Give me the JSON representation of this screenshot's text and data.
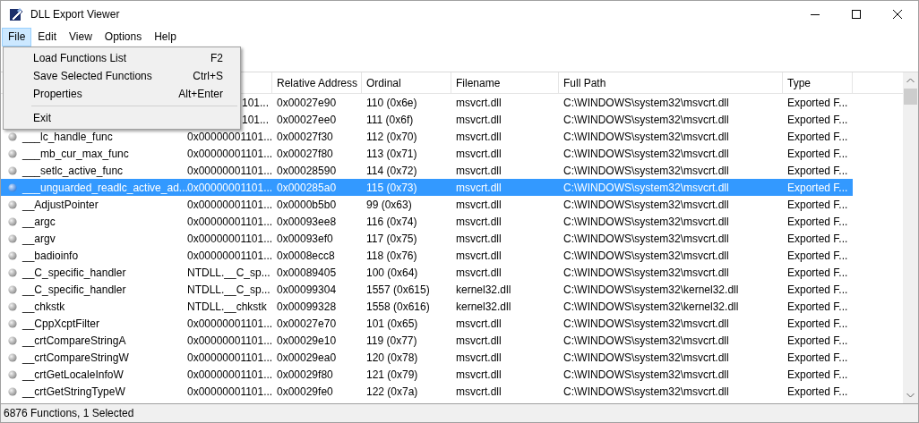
{
  "window": {
    "title": "DLL Export Viewer"
  },
  "menu_bar": [
    {
      "label": "File",
      "selected": true
    },
    {
      "label": "Edit",
      "selected": false
    },
    {
      "label": "View",
      "selected": false
    },
    {
      "label": "Options",
      "selected": false
    },
    {
      "label": "Help",
      "selected": false
    }
  ],
  "file_menu": [
    {
      "kind": "item",
      "label": "Load Functions List",
      "shortcut": "F2"
    },
    {
      "kind": "item",
      "label": "Save Selected Functions",
      "shortcut": "Ctrl+S"
    },
    {
      "kind": "item",
      "label": "Properties",
      "shortcut": "Alt+Enter"
    },
    {
      "kind": "separator"
    },
    {
      "kind": "item",
      "label": "Exit"
    }
  ],
  "table": {
    "columns": [
      "Relative Address",
      "Ordinal",
      "Filename",
      "Full Path",
      "Type"
    ],
    "rows": [
      {
        "address": "101...",
        "relative": "0x00027e90",
        "ordinal": "110 (0x6e)",
        "filename": "msvcrt.dll",
        "path": "C:\\WINDOWS\\system32\\msvcrt.dll",
        "type": "Exported F...",
        "selected": false
      },
      {
        "address": "101...",
        "relative": "0x00027ee0",
        "ordinal": "111 (0x6f)",
        "filename": "msvcrt.dll",
        "path": "C:\\WINDOWS\\system32\\msvcrt.dll",
        "type": "Exported F...",
        "selected": false
      },
      {
        "name": "___lc_handle_func",
        "address": "0x00000001101...",
        "relative": "0x00027f30",
        "ordinal": "112 (0x70)",
        "filename": "msvcrt.dll",
        "path": "C:\\WINDOWS\\system32\\msvcrt.dll",
        "type": "Exported F...",
        "selected": false
      },
      {
        "name": "___mb_cur_max_func",
        "address": "0x00000001101...",
        "relative": "0x00027f80",
        "ordinal": "113 (0x71)",
        "filename": "msvcrt.dll",
        "path": "C:\\WINDOWS\\system32\\msvcrt.dll",
        "type": "Exported F...",
        "selected": false
      },
      {
        "name": "___setlc_active_func",
        "address": "0x00000001101...",
        "relative": "0x00028590",
        "ordinal": "114 (0x72)",
        "filename": "msvcrt.dll",
        "path": "C:\\WINDOWS\\system32\\msvcrt.dll",
        "type": "Exported F...",
        "selected": false
      },
      {
        "name": "___unguarded_readlc_active_ad...",
        "address": "0x00000001101...",
        "relative": "0x000285a0",
        "ordinal": "115 (0x73)",
        "filename": "msvcrt.dll",
        "path": "C:\\WINDOWS\\system32\\msvcrt.dll",
        "type": "Exported F...",
        "selected": true
      },
      {
        "name": "__AdjustPointer",
        "address": "0x00000001101...",
        "relative": "0x0000b5b0",
        "ordinal": "99 (0x63)",
        "filename": "msvcrt.dll",
        "path": "C:\\WINDOWS\\system32\\msvcrt.dll",
        "type": "Exported F...",
        "selected": false
      },
      {
        "name": "__argc",
        "address": "0x00000001101...",
        "relative": "0x00093ee8",
        "ordinal": "116 (0x74)",
        "filename": "msvcrt.dll",
        "path": "C:\\WINDOWS\\system32\\msvcrt.dll",
        "type": "Exported F...",
        "selected": false
      },
      {
        "name": "__argv",
        "address": "0x00000001101...",
        "relative": "0x00093ef0",
        "ordinal": "117 (0x75)",
        "filename": "msvcrt.dll",
        "path": "C:\\WINDOWS\\system32\\msvcrt.dll",
        "type": "Exported F...",
        "selected": false
      },
      {
        "name": "__badioinfo",
        "address": "0x00000001101...",
        "relative": "0x0008ecc8",
        "ordinal": "118 (0x76)",
        "filename": "msvcrt.dll",
        "path": "C:\\WINDOWS\\system32\\msvcrt.dll",
        "type": "Exported F...",
        "selected": false
      },
      {
        "name": "__C_specific_handler",
        "address": "NTDLL.__C_sp...",
        "relative": "0x00089405",
        "ordinal": "100 (0x64)",
        "filename": "msvcrt.dll",
        "path": "C:\\WINDOWS\\system32\\msvcrt.dll",
        "type": "Exported F...",
        "selected": false
      },
      {
        "name": "__C_specific_handler",
        "address": "NTDLL.__C_sp...",
        "relative": "0x00099304",
        "ordinal": "1557 (0x615)",
        "filename": "kernel32.dll",
        "path": "C:\\WINDOWS\\system32\\kernel32.dll",
        "type": "Exported F...",
        "selected": false
      },
      {
        "name": "__chkstk",
        "address": "NTDLL.__chkstk",
        "relative": "0x00099328",
        "ordinal": "1558 (0x616)",
        "filename": "kernel32.dll",
        "path": "C:\\WINDOWS\\system32\\kernel32.dll",
        "type": "Exported F...",
        "selected": false
      },
      {
        "name": "__CppXcptFilter",
        "address": "0x00000001101...",
        "relative": "0x00027e70",
        "ordinal": "101 (0x65)",
        "filename": "msvcrt.dll",
        "path": "C:\\WINDOWS\\system32\\msvcrt.dll",
        "type": "Exported F...",
        "selected": false
      },
      {
        "name": "__crtCompareStringA",
        "address": "0x00000001101...",
        "relative": "0x00029e10",
        "ordinal": "119 (0x77)",
        "filename": "msvcrt.dll",
        "path": "C:\\WINDOWS\\system32\\msvcrt.dll",
        "type": "Exported F...",
        "selected": false
      },
      {
        "name": "__crtCompareStringW",
        "address": "0x00000001101...",
        "relative": "0x00029ea0",
        "ordinal": "120 (0x78)",
        "filename": "msvcrt.dll",
        "path": "C:\\WINDOWS\\system32\\msvcrt.dll",
        "type": "Exported F...",
        "selected": false
      },
      {
        "name": "__crtGetLocaleInfoW",
        "address": "0x00000001101...",
        "relative": "0x00029f80",
        "ordinal": "121 (0x79)",
        "filename": "msvcrt.dll",
        "path": "C:\\WINDOWS\\system32\\msvcrt.dll",
        "type": "Exported F...",
        "selected": false
      },
      {
        "name": "__crtGetStringTypeW",
        "address": "0x00000001101...",
        "relative": "0x00029fe0",
        "ordinal": "122 (0x7a)",
        "filename": "msvcrt.dll",
        "path": "C:\\WINDOWS\\system32\\msvcrt.dll",
        "type": "Exported F...",
        "selected": false
      }
    ]
  },
  "status_bar": "6876 Functions, 1 Selected"
}
